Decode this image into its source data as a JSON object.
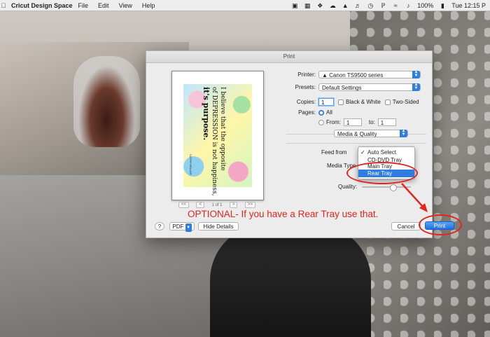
{
  "menubar": {
    "app_name": "Cricut Design Space",
    "items": [
      "File",
      "Edit",
      "View",
      "Help"
    ],
    "battery": "100%",
    "clock": "Tue 12:15 P"
  },
  "dialog": {
    "title": "Print",
    "preview": {
      "quote_line1": "I believe that the opposite",
      "quote_line2": "of DEPRESSION is not happiness,",
      "quote_line3": "it's purpose.",
      "author": "CATHY HELLER",
      "page_indicator": "1 of 1",
      "first_label": "<<",
      "prev_label": "<",
      "next_label": ">",
      "last_label": ">>"
    },
    "printer": {
      "label": "Printer:",
      "value": "Canon TS9500 series"
    },
    "presets": {
      "label": "Presets:",
      "value": "Default Settings"
    },
    "copies": {
      "label": "Copies:",
      "value": "1",
      "bw_label": "Black & White",
      "two_sided_label": "Two-Sided"
    },
    "pages": {
      "label": "Pages:",
      "all_label": "All",
      "from_label": "From:",
      "from_value": "1",
      "to_label": "to:",
      "to_value": "1"
    },
    "section_popup": "Media & Quality",
    "feed_from_label": "Feed from",
    "media_type_label": "Media Type",
    "media_type_partial": "st",
    "quality_label": "Quality:",
    "feed_options": [
      "Auto Select",
      "CD-DVD Tray",
      "Main Tray",
      "Rear Tray"
    ],
    "feed_selected": "Rear Tray",
    "help_label": "?",
    "pdf_label": "PDF",
    "hide_details_label": "Hide Details",
    "cancel_label": "Cancel",
    "print_label": "Print"
  },
  "annotation": {
    "note": "OPTIONAL- If you have a Rear Tray use that.",
    "color": "#e0261f"
  },
  "colors": {
    "accent": "#2f7de1",
    "annotation_red": "#e0261f"
  }
}
